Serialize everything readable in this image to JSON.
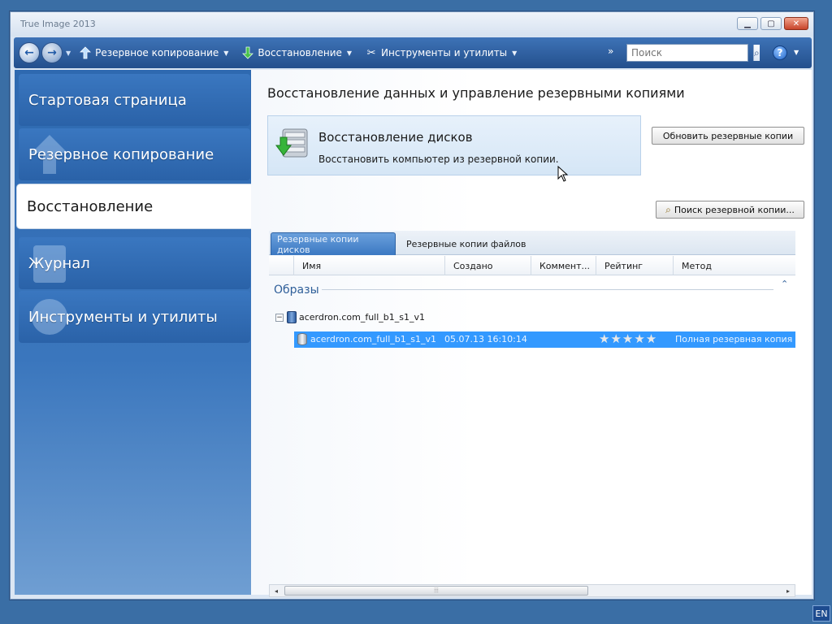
{
  "window": {
    "title": "True Image 2013"
  },
  "toolbar": {
    "items": [
      {
        "label": "Резервное копирование",
        "icon": "backup-arrow-icon"
      },
      {
        "label": "Восстановление",
        "icon": "recovery-arrow-icon"
      },
      {
        "label": "Инструменты и утилиты",
        "icon": "tools-icon"
      }
    ],
    "more": "»",
    "search_placeholder": "Поиск"
  },
  "sidebar": {
    "items": [
      {
        "label": "Стартовая страница",
        "active": false
      },
      {
        "label": "Резервное копирование",
        "active": false
      },
      {
        "label": "Восстановление",
        "active": true
      },
      {
        "label": "Журнал",
        "active": false
      },
      {
        "label": "Инструменты и утилиты",
        "active": false
      }
    ]
  },
  "main": {
    "title": "Восстановление данных и управление резервными копиями",
    "task": {
      "title": "Восстановление дисков",
      "desc": "Восстановить компьютер из резервной копии."
    },
    "refresh_button": "Обновить резервные копии",
    "find_button": "Поиск резервной копии...",
    "tabs": [
      "Резервные копии дисков",
      "Резервные копии файлов"
    ],
    "columns": [
      "Имя",
      "Создано",
      "Коммент...",
      "Рейтинг",
      "Метод"
    ],
    "group": "Образы",
    "tree": {
      "parent": "acerdron.com_full_b1_s1_v1",
      "child": {
        "name": "acerdron.com_full_b1_s1_v1",
        "created": "05.07.13 16:10:14",
        "rating": 5,
        "method": "Полная резервная копия"
      }
    }
  },
  "taskbar": {
    "lang": "EN"
  },
  "colors": {
    "toolbar": "#2e5f9f",
    "sidebar": "#3372b8",
    "selection": "#3399ff"
  }
}
